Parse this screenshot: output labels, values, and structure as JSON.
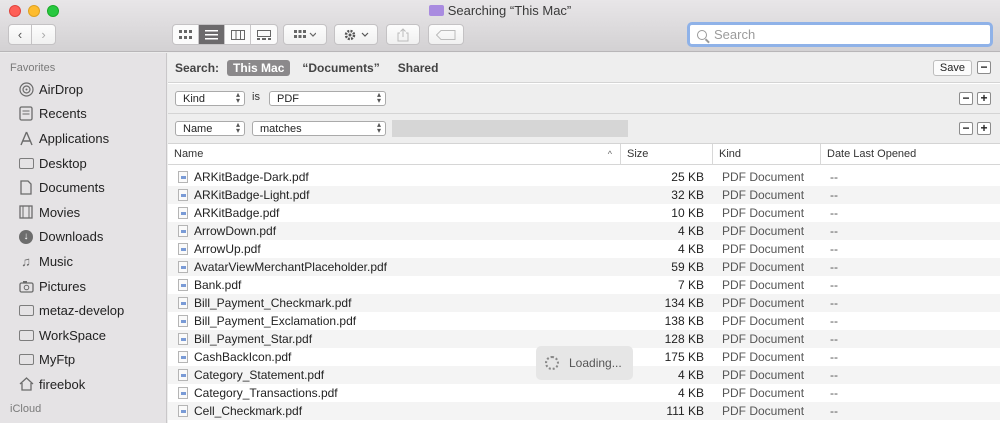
{
  "window": {
    "title": "Searching “This Mac”"
  },
  "toolbar": {
    "back_icon": "‹",
    "forward_icon": "›",
    "view_modes": [
      "icon-view",
      "list-view",
      "column-view",
      "gallery-view"
    ],
    "active_view": "list-view",
    "search_placeholder": "Search",
    "search_value": ""
  },
  "sidebar": {
    "favorites_heading": "Favorites",
    "items": [
      {
        "label": "AirDrop",
        "icon": "airdrop-icon"
      },
      {
        "label": "Recents",
        "icon": "recents-icon"
      },
      {
        "label": "Applications",
        "icon": "applications-icon"
      },
      {
        "label": "Desktop",
        "icon": "desktop-icon"
      },
      {
        "label": "Documents",
        "icon": "documents-icon"
      },
      {
        "label": "Movies",
        "icon": "movies-icon"
      },
      {
        "label": "Downloads",
        "icon": "downloads-icon"
      },
      {
        "label": "Music",
        "icon": "music-icon"
      },
      {
        "label": "Pictures",
        "icon": "pictures-icon"
      },
      {
        "label": "metaz-develop",
        "icon": "folder-icon"
      },
      {
        "label": "WorkSpace",
        "icon": "folder-icon"
      },
      {
        "label": "MyFtp",
        "icon": "folder-icon"
      },
      {
        "label": "fireebok",
        "icon": "home-icon"
      }
    ],
    "icloud_heading": "iCloud"
  },
  "scope": {
    "label": "Search:",
    "options": [
      "This Mac",
      "“Documents”",
      "Shared"
    ],
    "active": "This Mac",
    "save_label": "Save"
  },
  "criteria": [
    {
      "attribute": "Kind",
      "operator": "is",
      "value": "PDF"
    },
    {
      "attribute": "Name",
      "operator": "matches",
      "value": ""
    }
  ],
  "table": {
    "columns": [
      "Name",
      "Size",
      "Kind",
      "Date Last Opened"
    ],
    "sort_column": "Name",
    "sort_direction": "ascending",
    "rows": [
      {
        "name": "ARKitBadge-Dark.pdf",
        "size": "25 KB",
        "kind": "PDF Document",
        "date": "--"
      },
      {
        "name": "ARKitBadge-Light.pdf",
        "size": "32 KB",
        "kind": "PDF Document",
        "date": "--"
      },
      {
        "name": "ARKitBadge.pdf",
        "size": "10 KB",
        "kind": "PDF Document",
        "date": "--"
      },
      {
        "name": "ArrowDown.pdf",
        "size": "4 KB",
        "kind": "PDF Document",
        "date": "--"
      },
      {
        "name": "ArrowUp.pdf",
        "size": "4 KB",
        "kind": "PDF Document",
        "date": "--"
      },
      {
        "name": "AvatarViewMerchantPlaceholder.pdf",
        "size": "59 KB",
        "kind": "PDF Document",
        "date": "--"
      },
      {
        "name": "Bank.pdf",
        "size": "7 KB",
        "kind": "PDF Document",
        "date": "--"
      },
      {
        "name": "Bill_Payment_Checkmark.pdf",
        "size": "134 KB",
        "kind": "PDF Document",
        "date": "--"
      },
      {
        "name": "Bill_Payment_Exclamation.pdf",
        "size": "138 KB",
        "kind": "PDF Document",
        "date": "--"
      },
      {
        "name": "Bill_Payment_Star.pdf",
        "size": "128 KB",
        "kind": "PDF Document",
        "date": "--"
      },
      {
        "name": "CashBackIcon.pdf",
        "size": "175 KB",
        "kind": "PDF Document",
        "date": "--"
      },
      {
        "name": "Category_Statement.pdf",
        "size": "4 KB",
        "kind": "PDF Document",
        "date": "--"
      },
      {
        "name": "Category_Transactions.pdf",
        "size": "4 KB",
        "kind": "PDF Document",
        "date": "--"
      },
      {
        "name": "Cell_Checkmark.pdf",
        "size": "111 KB",
        "kind": "PDF Document",
        "date": "--"
      }
    ]
  },
  "loading_text": "Loading..."
}
